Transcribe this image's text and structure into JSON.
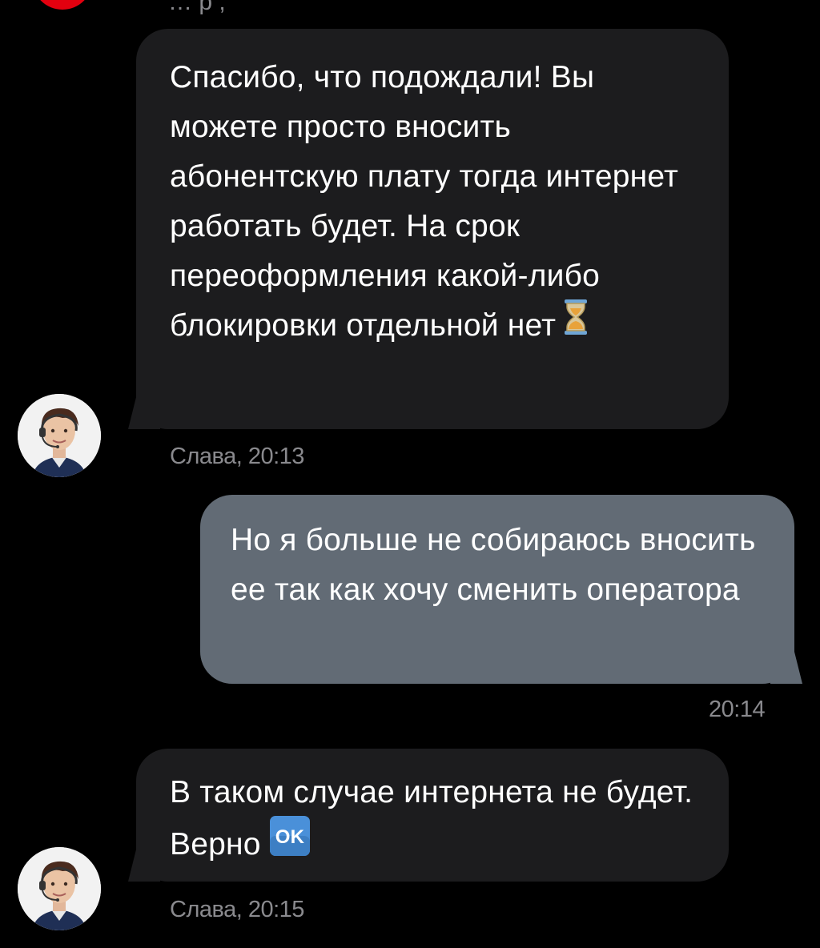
{
  "top_message": {
    "meta_fragment": "… р ,"
  },
  "messages": [
    {
      "direction": "incoming",
      "text": "Спасибо, что подождали! Вы можете просто вносить абонентскую плату тогда интернет работать будет. На срок переоформления какой-либо блокировки отдельной нет",
      "emoji": "hourglass-icon",
      "sender": "Слава",
      "time": "20:13",
      "meta": "Слава, 20:13"
    },
    {
      "direction": "outgoing",
      "text": "Но я больше не собираюсь вносить ее так как хочу сменить оператора",
      "time": "20:14",
      "meta": "20:14"
    },
    {
      "direction": "incoming",
      "text": "В таком случае интернета не будет. Верно",
      "emoji": "ok-icon",
      "emoji_text": "OK",
      "sender": "Слава",
      "time": "20:15",
      "meta": "Слава, 20:15"
    }
  ],
  "colors": {
    "background": "#000000",
    "incoming_bubble": "#1c1c1e",
    "outgoing_bubble": "#626b75",
    "text": "#ffffff",
    "meta_text": "#8a8a8e",
    "brand_red": "#e3000f",
    "ok_emoji": "#4a90d9"
  }
}
